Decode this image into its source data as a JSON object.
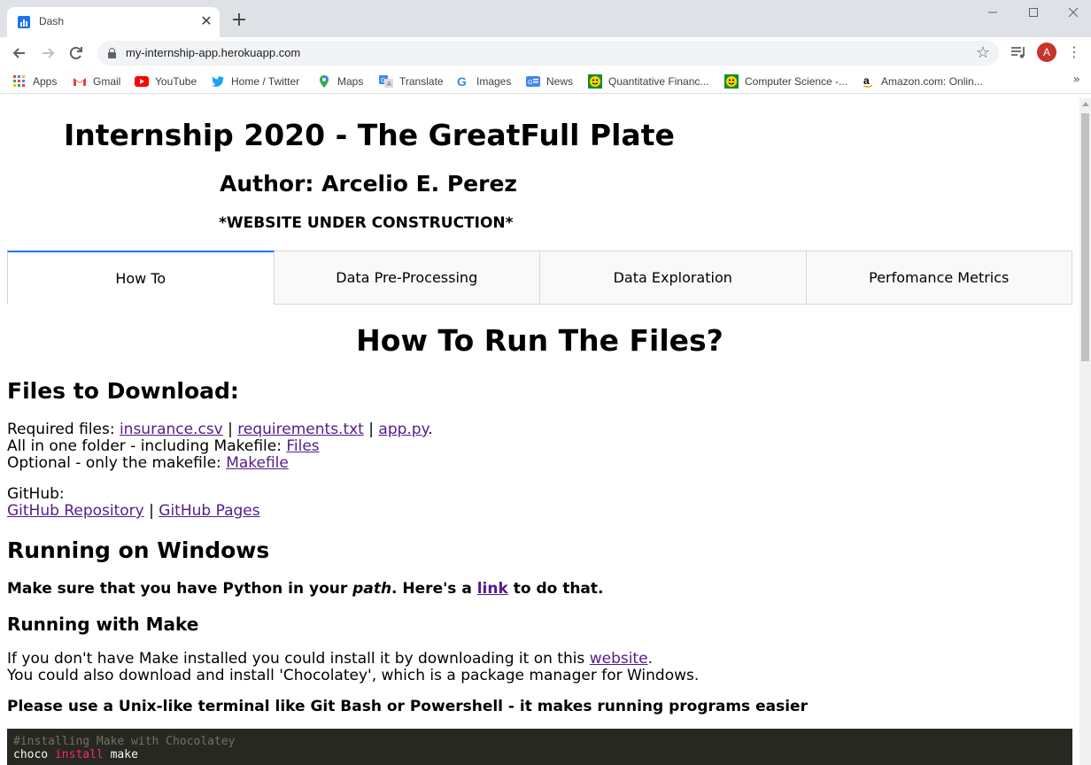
{
  "browser": {
    "tab_title": "Dash",
    "tab_close": "✕",
    "new_tab": "+",
    "url": "my-internship-app.herokuapp.com",
    "avatar_letter": "A",
    "bookmarks": [
      {
        "label": "Apps",
        "icon": "apps-grid-icon"
      },
      {
        "label": "Gmail",
        "icon": "gmail-icon"
      },
      {
        "label": "YouTube",
        "icon": "youtube-icon"
      },
      {
        "label": "Home / Twitter",
        "icon": "twitter-icon"
      },
      {
        "label": "Maps",
        "icon": "maps-pin-icon"
      },
      {
        "label": "Translate",
        "icon": "translate-icon"
      },
      {
        "label": "Images",
        "icon": "google-icon"
      },
      {
        "label": "News",
        "icon": "news-icon"
      },
      {
        "label": "Quantitative Financ...",
        "icon": "smiley-icon"
      },
      {
        "label": "Computer Science -...",
        "icon": "smiley-icon"
      },
      {
        "label": "Amazon.com: Onlin...",
        "icon": "amazon-icon"
      }
    ],
    "bookmarks_more": "»"
  },
  "page": {
    "title": "Internship 2020 - The GreatFull Plate",
    "author": "Author: Arcelio E. Perez",
    "construction": "*WEBSITE UNDER CONSTRUCTION*",
    "tabs": [
      {
        "label": "How To",
        "selected": true
      },
      {
        "label": "Data Pre-Processing",
        "selected": false
      },
      {
        "label": "Data Exploration",
        "selected": false
      },
      {
        "label": "Perfomance Metrics",
        "selected": false
      }
    ],
    "heading": "How To Run The Files?",
    "files_heading": "Files to Download:",
    "required_prefix": "Required files: ",
    "link_insurance": "insurance.csv",
    "sep1": " | ",
    "link_requirements": "requirements.txt",
    "sep2": " | ",
    "link_app": "app.py",
    "required_suffix": ".",
    "allinone_prefix": "All in one folder - including Makefile: ",
    "link_files": "Files",
    "optional_prefix": "Optional - only the makefile: ",
    "link_makefile": "Makefile",
    "github_label": "GitHub:",
    "link_github_repo": "GitHub Repository",
    "sep3": " | ",
    "link_github_pages": "GitHub Pages",
    "windows_heading": "Running on Windows",
    "python_text_1": "Make sure that you have Python in your ",
    "python_text_path": "path",
    "python_text_2": ". Here's a ",
    "link_link": "link",
    "python_text_3": " to do that.",
    "make_heading": "Running with Make",
    "make_text_1": "If you don't have Make installed you could install it by downloading it on this ",
    "link_website": "website",
    "make_text_2": ".",
    "choco_text": "You could also download and install 'Chocolatey', which is a package manager for Windows.",
    "unix_text": "Please use a Unix-like terminal like Git Bash or Powershell - it makes running programs easier",
    "code_comment": "#installing Make with Chocolatey",
    "code_cmd": "choco",
    "code_kw": "install",
    "code_arg": "make"
  },
  "colors": {
    "accent": "#1975fa",
    "link": "#551a8b",
    "code_bg": "#272822",
    "code_keyword": "#f92672"
  }
}
